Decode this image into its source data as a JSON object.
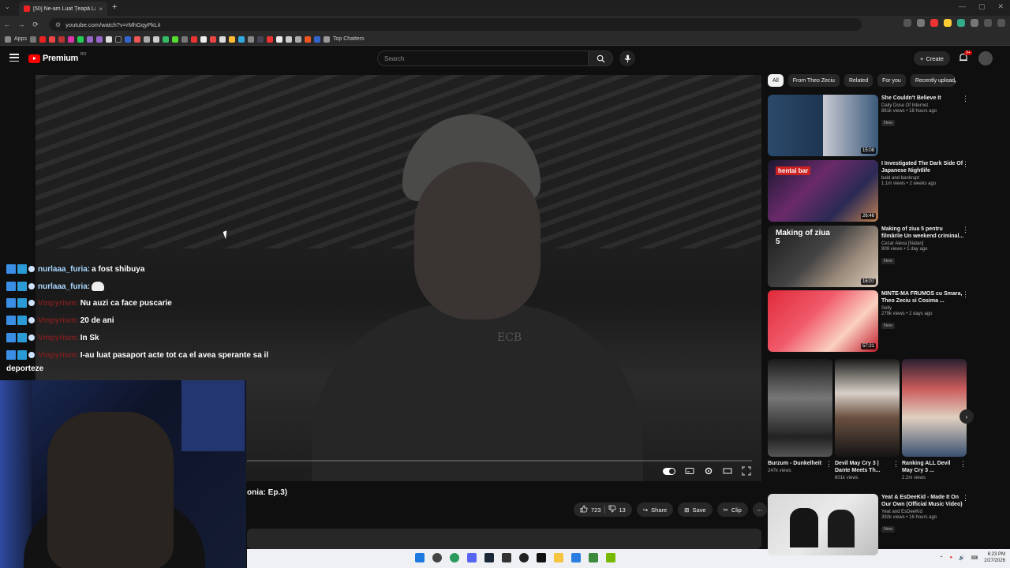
{
  "browser": {
    "tab_title": "[50] Ne-am Luat Țeapă La Targ...",
    "url": "youtube.com/watch?v=rMhGqyPkLiI",
    "bookmarks_apps_label": "Apps",
    "bookmark_last_label": "Top Chatters"
  },
  "masthead": {
    "logo_text": "Premium",
    "logo_country": "RO",
    "search_placeholder": "Search",
    "create_label": "Create",
    "notif_count": "9+"
  },
  "chat": {
    "messages": [
      {
        "user": "nurlaaa_furia:",
        "user_color": "#a9d8ff",
        "text": "a fost shibuya"
      },
      {
        "user": "nurlaaa_furia:",
        "user_color": "#a9d8ff",
        "text": ""
      },
      {
        "user": "Vmpyrism:",
        "user_color": "#7a1f1f",
        "text": "Nu auzi ca face puscarie"
      },
      {
        "user": "Vmpyrism:",
        "user_color": "#7a1f1f",
        "text": "20 de ani"
      },
      {
        "user": "Vmpyrism:",
        "user_color": "#7a1f1f",
        "text": "In Sk"
      },
      {
        "user": "Vmpyrism:",
        "user_color": "#7a1f1f",
        "text": "I-au luat pasaport acte tot ca el avea sperante sa il"
      }
    ],
    "wrap_text": "deporteze"
  },
  "video": {
    "title_fragment": "onia: Ep.3)",
    "progress": 0.0,
    "likes": "723",
    "dislikes": "13",
    "share_label": "Share",
    "save_label": "Save",
    "clip_label": "Clip"
  },
  "sidebar": {
    "chips": [
      "All",
      "From Theo Zeciu",
      "Related",
      "For you",
      "Recently uploaded"
    ],
    "recs": [
      {
        "title": "She Couldn't Believe It",
        "channel": "Daily Dose Of Internet",
        "views": "861k views • 18 hours ago",
        "badge": "New",
        "duration": "15:08"
      },
      {
        "title": "I Investigated The Dark Side Of Japanese Nightlife",
        "channel": "bald and bankrupt",
        "views": "1.1m views • 2 weeks ago",
        "badge": "",
        "duration": "26:46"
      },
      {
        "title": "Making of ziua 5 pentru filmările Un weekend criminal...",
        "channel": "Cezar Alexa [Natan]",
        "views": "909 views • 1 day ago",
        "badge": "New",
        "duration": "16:07"
      },
      {
        "title": "MINTE-MA FRUMOS cu Smara, Theo Zeciu si Cosima ...",
        "channel": "Selly",
        "views": "279k views • 2 days ago",
        "badge": "New",
        "duration": "57:21"
      },
      {
        "title": "Yeat & EsDeeKid - Made It On Our Own (Official Music Video)",
        "channel": "Yeat and EsDeeKid",
        "views": "392k views • 16 hours ago",
        "badge": "New",
        "duration": ""
      }
    ],
    "shorts": [
      {
        "title": "Burzum - Dunkelheit",
        "views": "247k views"
      },
      {
        "title": "Devil May Cry 3 | Dante Meets Th...",
        "views": "601k views"
      },
      {
        "title": "Ranking ALL Devil May Cry 3 ...",
        "views": "2.2m views"
      }
    ],
    "thumb_text_1": "hentai bar",
    "thumb_text_2": "Making of ziua 5"
  },
  "taskbar": {
    "time": "6:23 PM",
    "date": "2/27/2026"
  },
  "colors": {
    "accent": "#ff0000",
    "bg": "#0f0f0f"
  }
}
